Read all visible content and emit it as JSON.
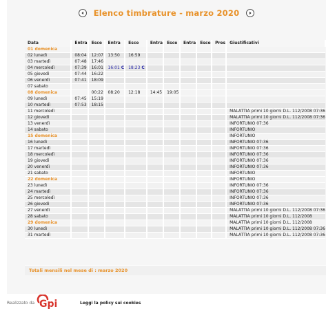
{
  "header": {
    "title": "Elenco timbrature - marzo 2020",
    "prev_icon": "left-arrow-circle-icon",
    "next_icon": "right-arrow-circle-icon"
  },
  "table": {
    "columns": [
      "Data",
      "Entra",
      "Esce",
      "Entra",
      "Esce",
      "Entra",
      "Esce",
      "Entra",
      "Esce",
      "Pres",
      "Giustificativi"
    ],
    "rows": [
      {
        "day": "01 domenica",
        "e1": "",
        "u1": "",
        "e2": "",
        "u2": "",
        "e3": "",
        "u3": "",
        "e4": "",
        "u4": "",
        "pres": "",
        "giust": "",
        "sunday": true
      },
      {
        "day": "02 lunedì",
        "e1": "08:04",
        "u1": "12:07",
        "e2": "13:50",
        "u2": "16:59",
        "e3": "",
        "u3": "",
        "e4": "",
        "u4": "",
        "pres": "",
        "giust": ""
      },
      {
        "day": "03 martedì",
        "e1": "07:48",
        "u1": "17:46",
        "e2": "",
        "u2": "",
        "e3": "",
        "u3": "",
        "e4": "",
        "u4": "",
        "pres": "",
        "giust": ""
      },
      {
        "day": "04 mercoledì",
        "e1": "07:39",
        "u1": "16:01",
        "e2": "16:01 C",
        "u2": "18:23 C",
        "e3": "",
        "u3": "",
        "e4": "",
        "u4": "",
        "pres": "",
        "giust": "",
        "blue": true
      },
      {
        "day": "05 giovedì",
        "e1": "07:44",
        "u1": "16:22",
        "e2": "",
        "u2": "",
        "e3": "",
        "u3": "",
        "e4": "",
        "u4": "",
        "pres": "",
        "giust": ""
      },
      {
        "day": "06 venerdì",
        "e1": "07:41",
        "u1": "18:09",
        "e2": "",
        "u2": "",
        "e3": "",
        "u3": "",
        "e4": "",
        "u4": "",
        "pres": "",
        "giust": ""
      },
      {
        "day": "07 sabato",
        "e1": "",
        "u1": "",
        "e2": "",
        "u2": "",
        "e3": "",
        "u3": "",
        "e4": "",
        "u4": "",
        "pres": "",
        "giust": ""
      },
      {
        "day": "08 domenica",
        "e1": "",
        "u1": "00:22",
        "e2": "08:20",
        "u2": "12:18",
        "e3": "14:45",
        "u3": "19:05",
        "e4": "",
        "u4": "",
        "pres": "",
        "giust": "",
        "sunday": true
      },
      {
        "day": "09 lunedì",
        "e1": "07:45",
        "u1": "15:19",
        "e2": "",
        "u2": "",
        "e3": "",
        "u3": "",
        "e4": "",
        "u4": "",
        "pres": "",
        "giust": ""
      },
      {
        "day": "10 martedì",
        "e1": "07:53",
        "u1": "18:15",
        "e2": "",
        "u2": "",
        "e3": "",
        "u3": "",
        "e4": "",
        "u4": "",
        "pres": "",
        "giust": ""
      },
      {
        "day": "11 mercoledì",
        "e1": "",
        "u1": "",
        "e2": "",
        "u2": "",
        "e3": "",
        "u3": "",
        "e4": "",
        "u4": "",
        "pres": "",
        "giust": "MALATTIA primi 10 giorni D.L. 112/2008 07:36"
      },
      {
        "day": "12 giovedì",
        "e1": "",
        "u1": "",
        "e2": "",
        "u2": "",
        "e3": "",
        "u3": "",
        "e4": "",
        "u4": "",
        "pres": "",
        "giust": "MALATTIA primi 10 giorni D.L. 112/2008 07:36"
      },
      {
        "day": "13 venerdì",
        "e1": "",
        "u1": "",
        "e2": "",
        "u2": "",
        "e3": "",
        "u3": "",
        "e4": "",
        "u4": "",
        "pres": "",
        "giust": "INFORTUNIO 07:36"
      },
      {
        "day": "14 sabato",
        "e1": "",
        "u1": "",
        "e2": "",
        "u2": "",
        "e3": "",
        "u3": "",
        "e4": "",
        "u4": "",
        "pres": "",
        "giust": "INFORTUNIO"
      },
      {
        "day": "15 domenica",
        "e1": "",
        "u1": "",
        "e2": "",
        "u2": "",
        "e3": "",
        "u3": "",
        "e4": "",
        "u4": "",
        "pres": "",
        "giust": "INFORTUNIO",
        "sunday": true
      },
      {
        "day": "16 lunedì",
        "e1": "",
        "u1": "",
        "e2": "",
        "u2": "",
        "e3": "",
        "u3": "",
        "e4": "",
        "u4": "",
        "pres": "",
        "giust": "INFORTUNIO 07:36"
      },
      {
        "day": "17 martedì",
        "e1": "",
        "u1": "",
        "e2": "",
        "u2": "",
        "e3": "",
        "u3": "",
        "e4": "",
        "u4": "",
        "pres": "",
        "giust": "INFORTUNIO 07:36"
      },
      {
        "day": "18 mercoledì",
        "e1": "",
        "u1": "",
        "e2": "",
        "u2": "",
        "e3": "",
        "u3": "",
        "e4": "",
        "u4": "",
        "pres": "",
        "giust": "INFORTUNIO 07:36"
      },
      {
        "day": "19 giovedì",
        "e1": "",
        "u1": "",
        "e2": "",
        "u2": "",
        "e3": "",
        "u3": "",
        "e4": "",
        "u4": "",
        "pres": "",
        "giust": "INFORTUNIO 07:36"
      },
      {
        "day": "20 venerdì",
        "e1": "",
        "u1": "",
        "e2": "",
        "u2": "",
        "e3": "",
        "u3": "",
        "e4": "",
        "u4": "",
        "pres": "",
        "giust": "INFORTUNIO 07:36"
      },
      {
        "day": "21 sabato",
        "e1": "",
        "u1": "",
        "e2": "",
        "u2": "",
        "e3": "",
        "u3": "",
        "e4": "",
        "u4": "",
        "pres": "",
        "giust": "INFORTUNIO"
      },
      {
        "day": "22 domenica",
        "e1": "",
        "u1": "",
        "e2": "",
        "u2": "",
        "e3": "",
        "u3": "",
        "e4": "",
        "u4": "",
        "pres": "",
        "giust": "INFORTUNIO",
        "sunday": true
      },
      {
        "day": "23 lunedì",
        "e1": "",
        "u1": "",
        "e2": "",
        "u2": "",
        "e3": "",
        "u3": "",
        "e4": "",
        "u4": "",
        "pres": "",
        "giust": "INFORTUNIO 07:36"
      },
      {
        "day": "24 martedì",
        "e1": "",
        "u1": "",
        "e2": "",
        "u2": "",
        "e3": "",
        "u3": "",
        "e4": "",
        "u4": "",
        "pres": "",
        "giust": "INFORTUNIO 07:36"
      },
      {
        "day": "25 mercoledì",
        "e1": "",
        "u1": "",
        "e2": "",
        "u2": "",
        "e3": "",
        "u3": "",
        "e4": "",
        "u4": "",
        "pres": "",
        "giust": "INFORTUNIO 07:36"
      },
      {
        "day": "26 giovedì",
        "e1": "",
        "u1": "",
        "e2": "",
        "u2": "",
        "e3": "",
        "u3": "",
        "e4": "",
        "u4": "",
        "pres": "",
        "giust": "INFORTUNIO 07:36"
      },
      {
        "day": "27 venerdì",
        "e1": "",
        "u1": "",
        "e2": "",
        "u2": "",
        "e3": "",
        "u3": "",
        "e4": "",
        "u4": "",
        "pres": "",
        "giust": "MALATTIA primi 10 giorni D.L. 112/2008 07:36"
      },
      {
        "day": "28 sabato",
        "e1": "",
        "u1": "",
        "e2": "",
        "u2": "",
        "e3": "",
        "u3": "",
        "e4": "",
        "u4": "",
        "pres": "",
        "giust": "MALATTIA primi 10 giorni D.L. 112/2008"
      },
      {
        "day": "29 domenica",
        "e1": "",
        "u1": "",
        "e2": "",
        "u2": "",
        "e3": "",
        "u3": "",
        "e4": "",
        "u4": "",
        "pres": "",
        "giust": "MALATTIA primi 10 giorni D.L. 112/2008",
        "sunday": true
      },
      {
        "day": "30 lunedì",
        "e1": "",
        "u1": "",
        "e2": "",
        "u2": "",
        "e3": "",
        "u3": "",
        "e4": "",
        "u4": "",
        "pres": "",
        "giust": "MALATTIA primi 10 giorni D.L. 112/2008 07:36"
      },
      {
        "day": "31 martedì",
        "e1": "",
        "u1": "",
        "e2": "",
        "u2": "",
        "e3": "",
        "u3": "",
        "e4": "",
        "u4": "",
        "pres": "",
        "giust": "MALATTIA primi 10 giorni D.L. 112/2008 07:36"
      }
    ]
  },
  "totals": {
    "label": "Totali mensili nel mese di : marzo 2020"
  },
  "footer": {
    "realizzato": "Realizzato da",
    "logo_text": "Gpi",
    "policy_link": "Leggi la policy sui cookies"
  },
  "colors": {
    "accent": "#e8922a",
    "blue_marker": "#2a2aa8",
    "logo_red": "#d8342c"
  }
}
